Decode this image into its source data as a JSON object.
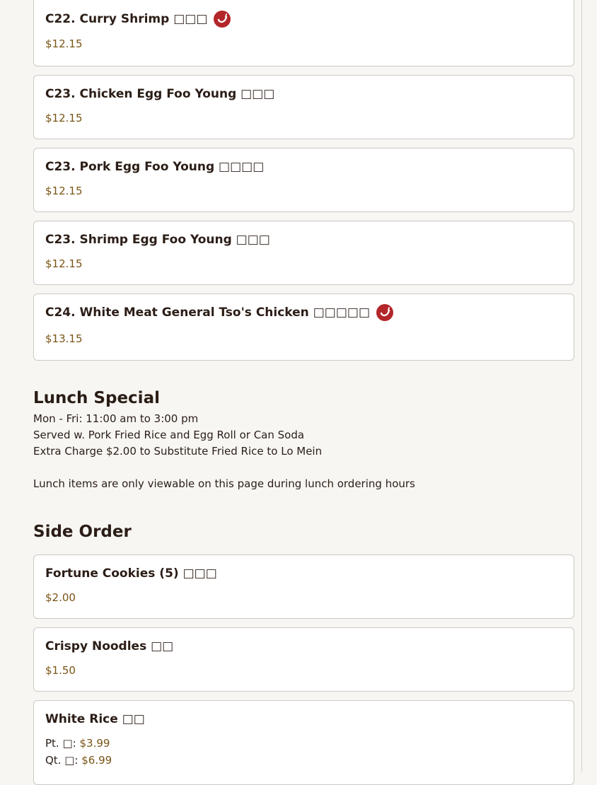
{
  "dinner_items": [
    {
      "name": "C22. Curry Shrimp □□□",
      "price": "$12.15",
      "spicy": true
    },
    {
      "name": "C23. Chicken Egg Foo Young □□□",
      "price": "$12.15",
      "spicy": false
    },
    {
      "name": "C23. Pork Egg Foo Young □□□□",
      "price": "$12.15",
      "spicy": false
    },
    {
      "name": "C23. Shrimp Egg Foo Young □□□",
      "price": "$12.15",
      "spicy": false
    },
    {
      "name": "C24. White Meat General Tso's Chicken □□□□□",
      "price": "$13.15",
      "spicy": true
    }
  ],
  "lunch_special": {
    "title": "Lunch Special",
    "hours": "Mon - Fri: 11:00 am to 3:00 pm",
    "served_with": "Served w. Pork Fried Rice and Egg Roll or Can Soda",
    "extra_charge": "Extra Charge $2.00 to Substitute Fried Rice to Lo Mein",
    "note": "Lunch items are only viewable on this page during lunch ordering hours"
  },
  "side_order": {
    "title": "Side Order",
    "items": [
      {
        "name": "Fortune Cookies (5) □□□",
        "price": "$2.00"
      },
      {
        "name": "Crispy Noodles □□",
        "price": "$1.50"
      },
      {
        "name": "White Rice □□",
        "sizes": [
          {
            "label": "Pt. □:",
            "price": "$3.99"
          },
          {
            "label": "Qt. □:",
            "price": "$6.99"
          }
        ]
      }
    ]
  },
  "icons": {
    "spicy": "chili-pepper-icon"
  },
  "colors": {
    "spicy_badge": "#b3262a",
    "price": "#7a5516",
    "card_border": "#cdc8c2",
    "background": "#f7f6f3"
  }
}
